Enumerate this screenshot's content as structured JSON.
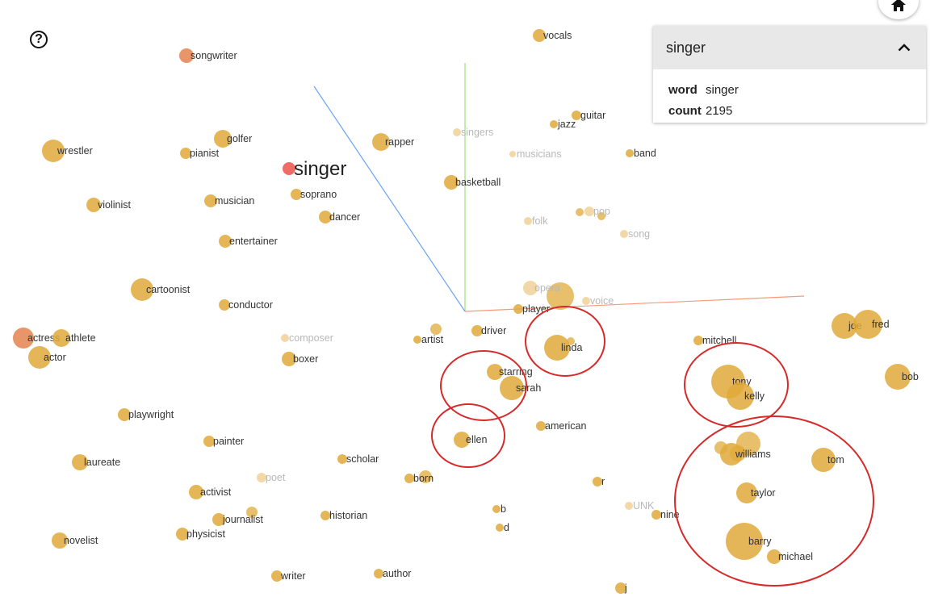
{
  "panel": {
    "title": "singer",
    "fields": [
      {
        "key": "word",
        "value": "singer"
      },
      {
        "key": "count",
        "value": "2195"
      }
    ]
  },
  "icons": {
    "help": "help-circle-icon",
    "home": "home-icon",
    "collapse": "chevron-up-icon"
  },
  "colors": {
    "point": "#E0A93A",
    "selected": "#F06A66",
    "neighbor_near": "#E58A5A",
    "highlight_circle": "#D62A2A",
    "axis_x": "#F59A7A",
    "axis_y": "#9BE07A",
    "axis_z": "#6AA2F0"
  },
  "points": [
    {
      "word": "vocals"
    },
    {
      "word": "songwriter",
      "tone": "near"
    },
    {
      "word": "guitar"
    },
    {
      "word": "jazz"
    },
    {
      "word": "singers",
      "faded": true
    },
    {
      "word": "musicians",
      "faded": true
    },
    {
      "word": "band"
    },
    {
      "word": "tommy",
      "faded": true
    },
    {
      "word": "golfer"
    },
    {
      "word": "wrestler"
    },
    {
      "word": "pianist"
    },
    {
      "word": "rapper"
    },
    {
      "word": "singer",
      "tone": "selected"
    },
    {
      "word": "basketball"
    },
    {
      "word": "soprano"
    },
    {
      "word": "violinist"
    },
    {
      "word": "musician"
    },
    {
      "word": "dancer"
    },
    {
      "word": "folk",
      "faded": true
    },
    {
      "word": "pop",
      "faded": true
    },
    {
      "word": "song",
      "faded": true
    },
    {
      "word": "entertainer"
    },
    {
      "word": "cartoonist"
    },
    {
      "word": "conductor"
    },
    {
      "word": "opera",
      "faded": true
    },
    {
      "word": "player"
    },
    {
      "word": "voice",
      "faded": true
    },
    {
      "word": "actress",
      "tone": "near"
    },
    {
      "word": "athlete"
    },
    {
      "word": "composer",
      "faded": true
    },
    {
      "word": "artist"
    },
    {
      "word": "driver"
    },
    {
      "word": "linda"
    },
    {
      "word": "mitchell"
    },
    {
      "word": "joe"
    },
    {
      "word": "fred"
    },
    {
      "word": "actor"
    },
    {
      "word": "boxer"
    },
    {
      "word": "starring"
    },
    {
      "word": "sarah"
    },
    {
      "word": "tony"
    },
    {
      "word": "kelly"
    },
    {
      "word": "bob"
    },
    {
      "word": "playwright"
    },
    {
      "word": "american"
    },
    {
      "word": "ellen"
    },
    {
      "word": "painter"
    },
    {
      "word": "laureate"
    },
    {
      "word": "scholar"
    },
    {
      "word": "williams"
    },
    {
      "word": "tom"
    },
    {
      "word": "poet",
      "faded": true
    },
    {
      "word": "born"
    },
    {
      "word": "r"
    },
    {
      "word": "activist"
    },
    {
      "word": "taylor"
    },
    {
      "word": "journalist"
    },
    {
      "word": "historian"
    },
    {
      "word": "b"
    },
    {
      "word": "UNK",
      "faded": true
    },
    {
      "word": "nine"
    },
    {
      "word": "d"
    },
    {
      "word": "physicist"
    },
    {
      "word": "barry"
    },
    {
      "word": "novelist"
    },
    {
      "word": "michael"
    },
    {
      "word": "writer"
    },
    {
      "word": "author"
    },
    {
      "word": "j"
    }
  ]
}
